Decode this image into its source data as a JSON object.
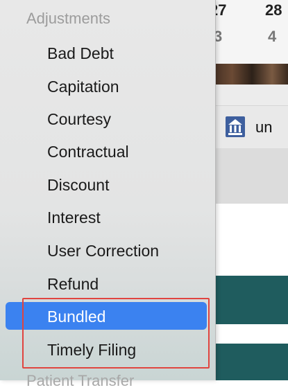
{
  "calendar": {
    "days": [
      "27",
      "28"
    ],
    "numbers": [
      "3",
      "4"
    ]
  },
  "user_bar": {
    "icon": "building-icon",
    "text": "un"
  },
  "menu": {
    "header": "Adjustments",
    "items": [
      {
        "label": "Bad Debt",
        "selected": false
      },
      {
        "label": "Capitation",
        "selected": false
      },
      {
        "label": "Courtesy",
        "selected": false
      },
      {
        "label": "Contractual",
        "selected": false
      },
      {
        "label": "Discount",
        "selected": false
      },
      {
        "label": "Interest",
        "selected": false
      },
      {
        "label": "User Correction",
        "selected": false
      },
      {
        "label": "Refund",
        "selected": false
      },
      {
        "label": "Bundled",
        "selected": true
      },
      {
        "label": "Timely Filing",
        "selected": false
      }
    ],
    "footer": "Patient Transfer",
    "selected_color": "#3b82f0",
    "highlight_color": "#e0443f"
  }
}
